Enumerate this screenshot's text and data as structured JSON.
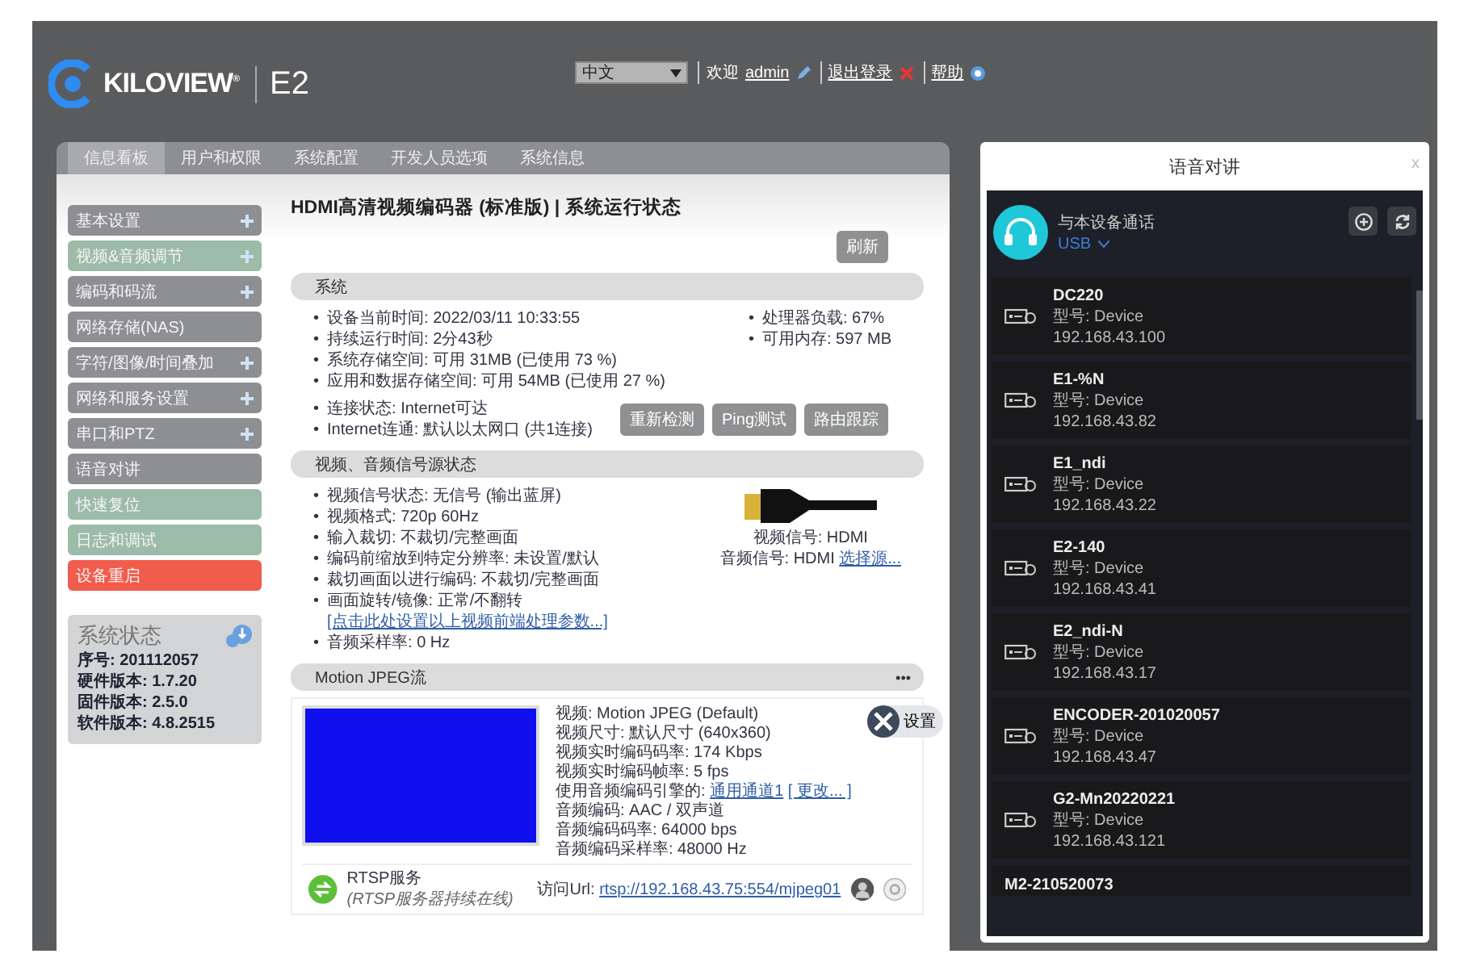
{
  "header": {
    "brand": "KILOVIEW",
    "trademark": "®",
    "model": "E2",
    "language": {
      "value": "中文"
    },
    "welcome": "欢迎",
    "user": "admin",
    "logout": "退出登录",
    "help": "帮助"
  },
  "tabs": [
    {
      "label": "信息看板",
      "selected": true
    },
    {
      "label": "用户和权限",
      "selected": false
    },
    {
      "label": "系统配置",
      "selected": false
    },
    {
      "label": "开发人员选项",
      "selected": false
    },
    {
      "label": "系统信息",
      "selected": false
    }
  ],
  "sidebar": {
    "items": [
      {
        "label": "基本设置",
        "color": "#8e8f93",
        "expandable": true
      },
      {
        "label": "视频&音频调节",
        "color": "#9dbba9",
        "expandable": true
      },
      {
        "label": "编码和码流",
        "color": "#8e8f93",
        "expandable": true
      },
      {
        "label": "网络存储(NAS)",
        "color": "#8e8f93",
        "expandable": false
      },
      {
        "label": "字符/图像/时间叠加",
        "color": "#8e8f93",
        "expandable": true
      },
      {
        "label": "网络和服务设置",
        "color": "#8e8f93",
        "expandable": true
      },
      {
        "label": "串口和PTZ",
        "color": "#8e8f93",
        "expandable": true
      },
      {
        "label": "语音对讲",
        "color": "#8e8f93",
        "expandable": false
      },
      {
        "label": "快速复位",
        "color": "#9dbba9",
        "expandable": false
      },
      {
        "label": "日志和调试",
        "color": "#9dbba9",
        "expandable": false
      },
      {
        "label": "设备重启",
        "color": "#f25c4c",
        "expandable": false
      }
    ],
    "status": {
      "title": "系统状态",
      "lines": [
        "序号: 201112057",
        "硬件版本: 1.7.20",
        "固件版本: 2.5.0",
        "软件版本: 4.8.2515"
      ]
    }
  },
  "main": {
    "bullet": "•",
    "title": "HDMI高清视频编码器 (标准版) | 系统运行状态",
    "refresh": "刷新",
    "system": {
      "heading": "系统",
      "left": [
        "设备当前时间: 2022/03/11 10:33:55",
        "持续运行时间: 2分43秒",
        "系统存储空间: 可用 31MB (已使用 73 %)",
        "应用和数据存储空间: 可用 54MB (已使用 27 %)"
      ],
      "right": [
        "处理器负载: 67%",
        "可用内存: 597 MB"
      ],
      "network": [
        "连接状态: Internet可达",
        "Internet连通: 默认以太网口 (共1连接)"
      ],
      "buttons": [
        "重新检测",
        "Ping测试",
        "路由跟踪"
      ]
    },
    "signal": {
      "heading": "视频、音频信号源状态",
      "items": [
        {
          "text": "视频信号状态: 无信号 (输出蓝屏)"
        },
        {
          "text": "视频格式: 720p 60Hz"
        },
        {
          "text": "输入裁切: 不裁切/完整画面"
        },
        {
          "text": "编码前缩放到特定分辨率: 未设置/默认"
        },
        {
          "text": "裁切画面以进行编码: 不裁切/完整画面"
        },
        {
          "text": "画面旋转/镜像: 正常/不翻转",
          "link": "[点击此处设置以上视频前端处理参数...]"
        },
        {
          "text": "音频采样率: 0 Hz"
        }
      ],
      "video_source": "视频信号: HDMI",
      "audio_source": "音频信号: HDMI",
      "audio_link": "选择源..."
    },
    "stream": {
      "heading": "Motion JPEG流",
      "more": "•••",
      "lines": [
        "视频: Motion JPEG (Default)",
        "视频尺寸: 默认尺寸 (640x360)",
        "视频实时编码码率: 174 Kbps",
        "视频实时编码帧率: 5 fps"
      ],
      "engine_label": "使用音频编码引擎的:",
      "engine_link": "通用通道1",
      "change_link": "[ 更改... ]",
      "audio_lines": [
        "音频编码: AAC / 双声道",
        "音频编码码率: 64000 bps",
        "音频编码采样率: 48000 Hz"
      ],
      "settings": "设置",
      "service": "RTSP服务",
      "service_note": "(RTSP服务器持续在线)",
      "url_label": "访问Url:",
      "url": "rtsp://192.168.43.75:554/mjpeg01"
    }
  },
  "intercom": {
    "title": "语音对讲",
    "close": "x",
    "call_label": "与本设备通话",
    "input": "USB",
    "devices": [
      {
        "name": "DC220",
        "model": "型号: Device",
        "ip": "192.168.43.100"
      },
      {
        "name": "E1-%N",
        "model": "型号: Device",
        "ip": "192.168.43.82"
      },
      {
        "name": "E1_ndi",
        "model": "型号: Device",
        "ip": "192.168.43.22"
      },
      {
        "name": "E2-140",
        "model": "型号: Device",
        "ip": "192.168.43.41"
      },
      {
        "name": "E2_ndi-N",
        "model": "型号: Device",
        "ip": "192.168.43.17"
      },
      {
        "name": "ENCODER-201020057",
        "model": "型号: Device",
        "ip": "192.168.43.47"
      },
      {
        "name": "G2-Mn20220221",
        "model": "型号: Device",
        "ip": "192.168.43.121"
      },
      {
        "name": "M2-210520073"
      }
    ]
  }
}
